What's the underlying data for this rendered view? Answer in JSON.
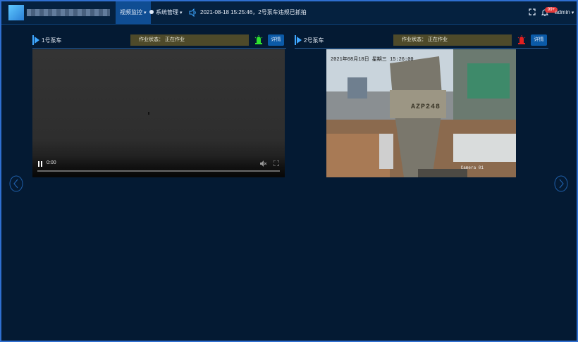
{
  "header": {
    "nav": [
      {
        "label": "视频监控"
      },
      {
        "label": "系统管理"
      }
    ],
    "alert_text": "2021-08-18 15:25:46，2号泵车违规已抓拍",
    "notification_badge": "99+",
    "username": "admin"
  },
  "panels": [
    {
      "title": "1号泵车",
      "status_label": "作业状态：",
      "status_value": "正在作业",
      "light_color": "#2fe22f",
      "detail_label": "详情",
      "video": {
        "time": "0:00",
        "progress": 0
      }
    },
    {
      "title": "2号泵车",
      "status_label": "作业状态：",
      "status_value": "正在作业",
      "light_color": "#e02020",
      "detail_label": "详情",
      "camera": {
        "timestamp": "2021年08月18日  星期三  15:26:00",
        "plate": "AZP248",
        "label": "Camera 01"
      }
    }
  ],
  "colors": {
    "page_bg": "#041a33",
    "accent": "#0f4d93",
    "status_bg": "#4e4a2a"
  }
}
